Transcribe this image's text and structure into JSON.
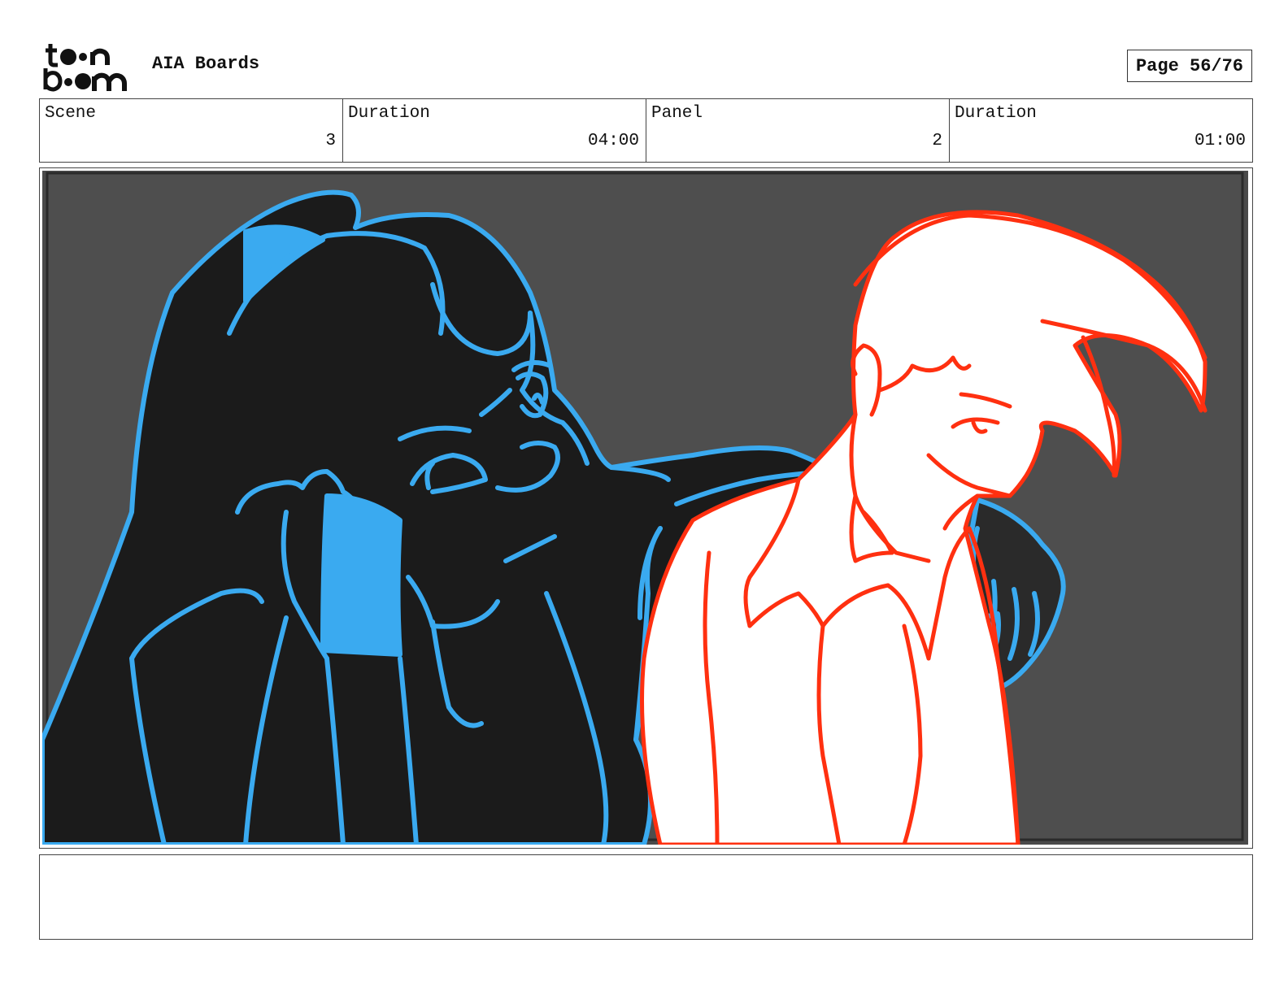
{
  "header": {
    "logo_text": "toon boom",
    "project_title": "AIA Boards",
    "page_indicator": "Page 56/76"
  },
  "info_table": {
    "scene_label": "Scene",
    "scene_value": "3",
    "scene_duration_label": "Duration",
    "scene_duration_value": "04:00",
    "panel_label": "Panel",
    "panel_value": "2",
    "panel_duration_label": "Duration",
    "panel_duration_value": "01:00"
  },
  "panel": {
    "background_color": "#4a4a4a",
    "left_character_outline_color": "#3aaaf0",
    "right_character_outline_color": "#ff3010"
  },
  "notes": {
    "text": ""
  }
}
